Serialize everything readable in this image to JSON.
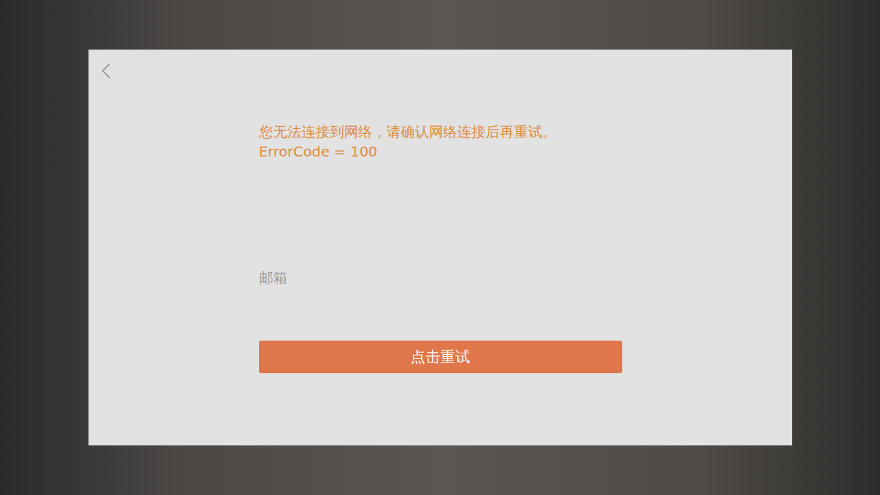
{
  "dialog": {
    "message": "您无法连接到网络，请确认网络连接后再重试。",
    "error_code": "ErrorCode = 100",
    "email": {
      "placeholder": "邮箱"
    },
    "button": "点击重试"
  }
}
